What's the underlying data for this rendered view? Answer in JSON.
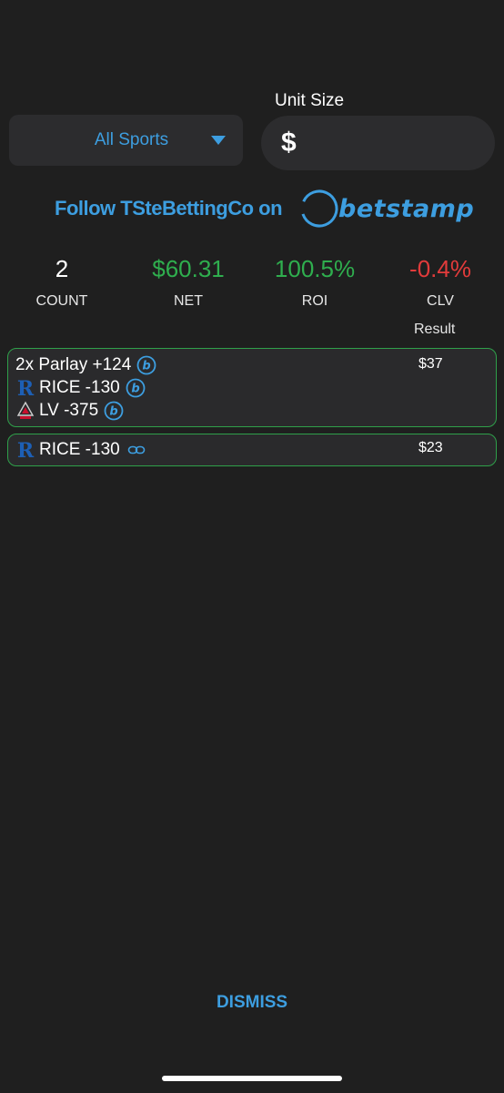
{
  "filter": {
    "sport_selected": "All Sports",
    "unit_size_label": "Unit Size",
    "unit_currency": "$",
    "unit_value": ""
  },
  "follow": {
    "text": "Follow TSteBettingCo on",
    "brand": "betstamp"
  },
  "stats": {
    "count": {
      "value": "2",
      "label": "COUNT"
    },
    "net": {
      "value": "$60.31",
      "label": "NET"
    },
    "roi": {
      "value": "100.5%",
      "label": "ROI"
    },
    "clv": {
      "value": "-0.4%",
      "label": "CLV"
    }
  },
  "result_header": "Result",
  "bets": [
    {
      "type": "parlay",
      "title": "2x Parlay +124",
      "result": "$37",
      "legs": [
        {
          "team_icon": "rice-owls-logo-icon",
          "text": "RICE -130"
        },
        {
          "team_icon": "las-vegas-aces-logo-icon",
          "text": "LV -375"
        }
      ]
    },
    {
      "type": "single",
      "team_icon": "rice-owls-logo-icon",
      "text": "RICE -130",
      "result": "$23"
    }
  ],
  "colors": {
    "accent": "#3d9ee0",
    "positive": "#2fae4e",
    "negative": "#e23b3b",
    "card_border": "#2fa04a",
    "background": "#1f1f1f"
  },
  "footer": {
    "dismiss_label": "DISMISS"
  }
}
